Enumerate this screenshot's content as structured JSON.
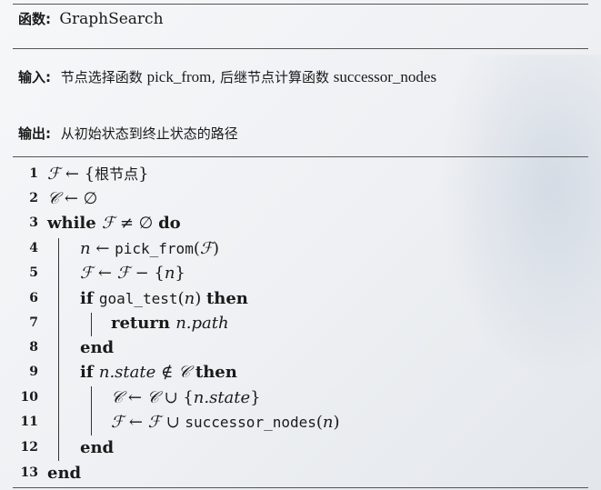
{
  "header": {
    "label": "函数:",
    "name": "GraphSearch"
  },
  "input": {
    "label": "输入:",
    "t1": "节点选择函数",
    "f1": "pick_from",
    "sep": ",",
    "t2": "后继节点计算函数",
    "f2": "successor_nodes"
  },
  "output": {
    "label": "输出:",
    "text": "从初始状态到终止状态的路径"
  },
  "algorithm": {
    "lines": [
      {
        "num": "1",
        "parts": [
          [
            "cal",
            "ℱ"
          ],
          [
            "txt",
            " ← {"
          ],
          [
            "zh",
            "根节点"
          ],
          [
            "txt",
            "}"
          ]
        ]
      },
      {
        "num": "2",
        "parts": [
          [
            "cal",
            "𝒞"
          ],
          [
            "txt",
            " ← ∅"
          ]
        ]
      },
      {
        "num": "3",
        "parts": [
          [
            "kw",
            "while "
          ],
          [
            "cal",
            "ℱ"
          ],
          [
            "txt",
            " ≠ ∅ "
          ],
          [
            "kw",
            "do"
          ]
        ]
      },
      {
        "num": "4",
        "parts": [
          [
            "it",
            "n"
          ],
          [
            "txt",
            " ← "
          ],
          [
            "mono",
            "pick_from"
          ],
          [
            "txt",
            "("
          ],
          [
            "cal",
            "ℱ"
          ],
          [
            "txt",
            ")"
          ]
        ]
      },
      {
        "num": "5",
        "parts": [
          [
            "cal",
            "ℱ"
          ],
          [
            "txt",
            " ← "
          ],
          [
            "cal",
            "ℱ"
          ],
          [
            "txt",
            " − {"
          ],
          [
            "it",
            "n"
          ],
          [
            "txt",
            "}"
          ]
        ]
      },
      {
        "num": "6",
        "parts": [
          [
            "kw",
            "if "
          ],
          [
            "mono",
            "goal_test"
          ],
          [
            "txt",
            "("
          ],
          [
            "it",
            "n"
          ],
          [
            "txt",
            ") "
          ],
          [
            "kw",
            "then"
          ]
        ]
      },
      {
        "num": "7",
        "parts": [
          [
            "kw",
            "return "
          ],
          [
            "it",
            "n.path"
          ]
        ]
      },
      {
        "num": "8",
        "parts": [
          [
            "kw",
            "end"
          ]
        ]
      },
      {
        "num": "9",
        "parts": [
          [
            "kw",
            "if "
          ],
          [
            "it",
            "n.state"
          ],
          [
            "txt",
            " ∉ "
          ],
          [
            "cal",
            "𝒞"
          ],
          [
            "txt",
            " "
          ],
          [
            "kw",
            "then"
          ]
        ]
      },
      {
        "num": "10",
        "parts": [
          [
            "cal",
            "𝒞"
          ],
          [
            "txt",
            " ← "
          ],
          [
            "cal",
            "𝒞"
          ],
          [
            "txt",
            " ∪ {"
          ],
          [
            "it",
            "n.state"
          ],
          [
            "txt",
            "}"
          ]
        ]
      },
      {
        "num": "11",
        "parts": [
          [
            "cal",
            "ℱ"
          ],
          [
            "txt",
            " ← "
          ],
          [
            "cal",
            "ℱ"
          ],
          [
            "txt",
            " ∪ "
          ],
          [
            "mono",
            "successor_nodes"
          ],
          [
            "txt",
            "("
          ],
          [
            "it",
            "n"
          ],
          [
            "txt",
            ")"
          ]
        ]
      },
      {
        "num": "12",
        "parts": [
          [
            "kw",
            "end"
          ]
        ]
      },
      {
        "num": "13",
        "parts": [
          [
            "kw",
            "end"
          ]
        ]
      }
    ]
  }
}
